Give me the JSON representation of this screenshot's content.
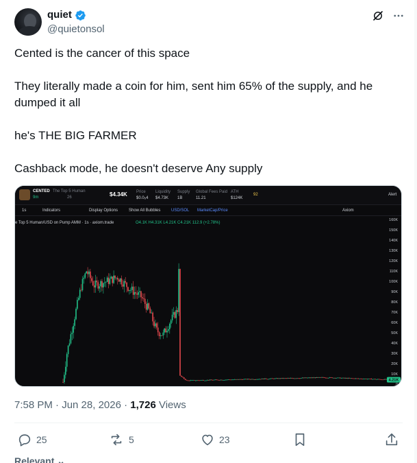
{
  "author": {
    "name": "quiet",
    "handle": "@quietonsol"
  },
  "tweet": {
    "paragraphs": [
      "Cented is the cancer of this space",
      "They literally made a coin for him, sent him 65% of the supply, and he dumped it all",
      "he's THE BIG FARMER",
      "Cashback mode, he doesn't deserve Any supply"
    ],
    "time": "7:58 PM · Jun 28, 2026 · ",
    "views_count": "1,726",
    "views_label": " Views"
  },
  "actions": {
    "replies": "25",
    "reposts": "5",
    "likes": "23"
  },
  "footer": {
    "relevant": "Relevant"
  },
  "media": {
    "topbar": {
      "ticker": "CENTED",
      "coin_name": "The Top 5 Human",
      "age": "9m",
      "holders": "26",
      "mcap": "$4.34K",
      "price_label": "Price",
      "price": "$0.0₅4",
      "liquidity_label": "Liquidity",
      "liquidity": "$4.73K",
      "supply_label": "Supply",
      "supply": "1B",
      "fees_label": "Global Fees Paid",
      "fees": "11.21",
      "ath_label": "ATH",
      "ath": "$124K",
      "count": "92",
      "alert": "Alert"
    },
    "toolbar": {
      "interval": "1s",
      "indicators": "Indicators",
      "display": "Display Options",
      "bubbles": "Show All Bubbles",
      "usd_sol": "USD/SOL",
      "mcap_price": "MarketCap/Price",
      "source": "Axiom"
    },
    "legend": {
      "pair": "e Top 5 Human/USD on Pump AMM · 1s · axiom.trade",
      "ohlc": "O4.1K H4.31K L4.21K C4.21K 112.9 (+2.78%)"
    },
    "current_value": "4.21K",
    "current_value_tag": "4.34K"
  },
  "chart_data": {
    "type": "candlestick",
    "y_tick_labels": [
      "160K",
      "150K",
      "140K",
      "130K",
      "120K",
      "110K",
      "100K",
      "90K",
      "80K",
      "70K",
      "60K",
      "50K",
      "40K",
      "30K",
      "20K",
      "10K",
      "0"
    ],
    "ylim": [
      0,
      160000
    ],
    "ath_value": 124000,
    "current_value": 4210,
    "colors": {
      "up": "#22c28a",
      "down": "#e5484d",
      "background": "#0b0b0d",
      "axis_text": "#c7cbd1"
    }
  }
}
